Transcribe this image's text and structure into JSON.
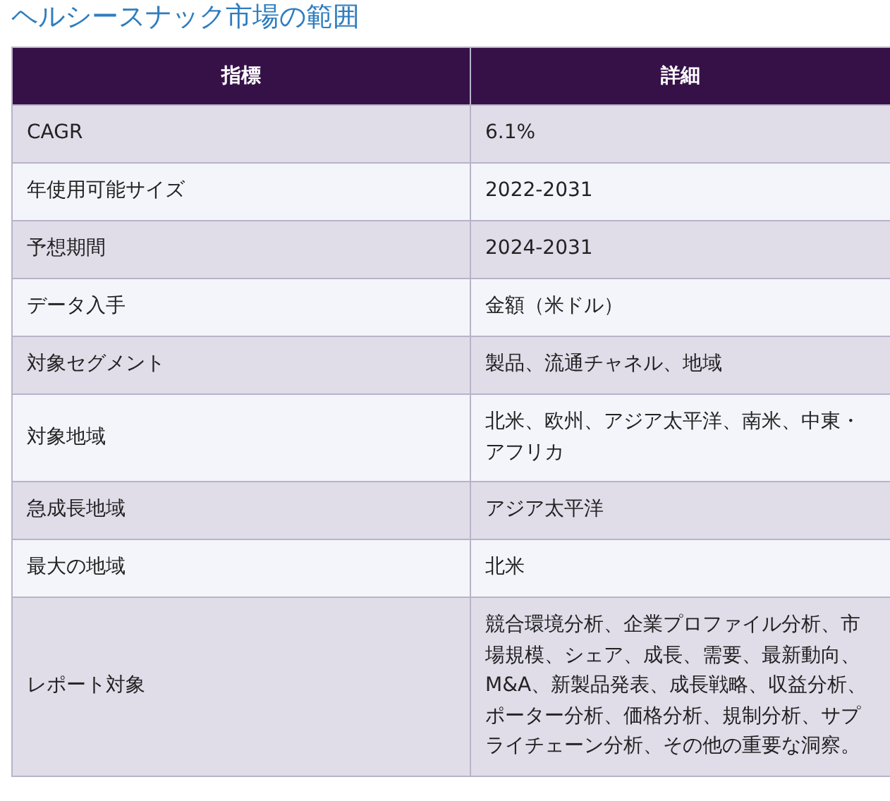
{
  "title": "ヘルシースナック市場の範囲",
  "table": {
    "columns": [
      "指標",
      "詳細"
    ],
    "rows": [
      {
        "metric": "CAGR",
        "detail": "6.1%"
      },
      {
        "metric": "年使用可能サイズ",
        "detail": "2022-2031"
      },
      {
        "metric": "予想期間",
        "detail": "2024-2031"
      },
      {
        "metric": "データ入手",
        "detail": "金額（米ドル）"
      },
      {
        "metric": "対象セグメント",
        "detail": "製品、流通チャネル、地域"
      },
      {
        "metric": "対象地域",
        "detail": "北米、欧州、アジア太平洋、南米、中東・アフリカ"
      },
      {
        "metric": "急成長地域",
        "detail": "アジア太平洋"
      },
      {
        "metric": "最大の地域",
        "detail": "北米"
      },
      {
        "metric": "レポート対象",
        "detail": "競合環境分析、企業プロファイル分析、市場規模、シェア、成長、需要、最新動向、M&A、新製品発表、成長戦略、収益分析、ポーター分析、価格分析、規制分析、サプライチェーン分析、その他の重要な洞察。"
      }
    ]
  }
}
